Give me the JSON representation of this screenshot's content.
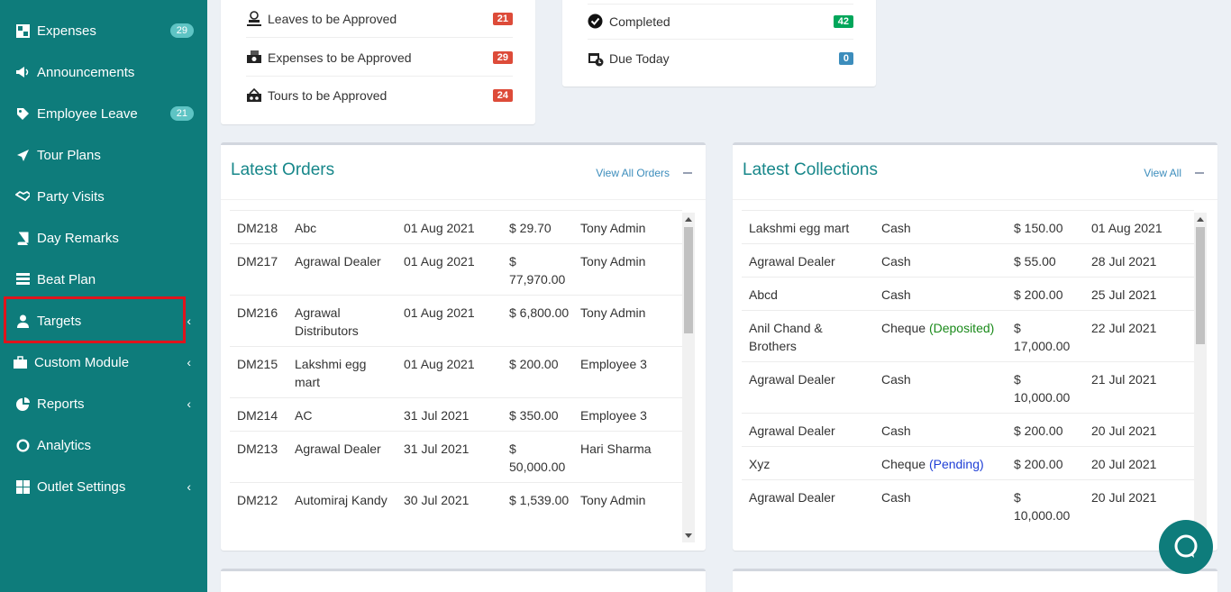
{
  "sidebar": {
    "items": [
      {
        "label": "Expenses",
        "icon": "expenses-icon",
        "badge": "29"
      },
      {
        "label": "Announcements",
        "icon": "bullhorn-icon"
      },
      {
        "label": "Employee Leave",
        "icon": "tag-icon",
        "badge": "21"
      },
      {
        "label": "Tour Plans",
        "icon": "paper-plane-icon"
      },
      {
        "label": "Party Visits",
        "icon": "handshake-icon"
      },
      {
        "label": "Day Remarks",
        "icon": "book-icon"
      },
      {
        "label": "Beat Plan",
        "icon": "list-icon"
      },
      {
        "label": "Targets",
        "icon": "user-icon",
        "chevron": "‹"
      },
      {
        "label": "Custom Module",
        "icon": "briefcase-icon",
        "chevron": "‹"
      },
      {
        "label": "Reports",
        "icon": "pie-chart-icon",
        "chevron": "‹"
      },
      {
        "label": "Analytics",
        "icon": "circle-icon"
      },
      {
        "label": "Outlet Settings",
        "icon": "grid-icon",
        "chevron": "‹"
      }
    ]
  },
  "approvals": [
    {
      "label": "Leaves to be Approved",
      "count": "21"
    },
    {
      "label": "Expenses to be Approved",
      "count": "29"
    },
    {
      "label": "Tours to be Approved",
      "count": "24"
    }
  ],
  "tasks": [
    {
      "label": "Completed",
      "count": "42"
    },
    {
      "label": "Due Today",
      "count": "0"
    }
  ],
  "orders": {
    "title": "Latest Orders",
    "view_all": "View All Orders",
    "rows": [
      {
        "id": "DM218",
        "party": "Abc",
        "date": "01 Aug 2021",
        "amount": "$ 29.70",
        "by": "Tony Admin"
      },
      {
        "id": "DM217",
        "party": "Agrawal Dealer",
        "date": "01 Aug 2021",
        "amount": "$ 77,970.00",
        "by": "Tony Admin"
      },
      {
        "id": "DM216",
        "party": "Agrawal Distributors",
        "date": "01 Aug 2021",
        "amount": "$ 6,800.00",
        "by": "Tony Admin"
      },
      {
        "id": "DM215",
        "party": "Lakshmi egg mart",
        "date": "01 Aug 2021",
        "amount": "$ 200.00",
        "by": "Employee 3"
      },
      {
        "id": "DM214",
        "party": "AC",
        "date": "31 Jul 2021",
        "amount": "$ 350.00",
        "by": "Employee 3"
      },
      {
        "id": "DM213",
        "party": "Agrawal Dealer",
        "date": "31 Jul 2021",
        "amount": "$ 50,000.00",
        "by": "Hari Sharma"
      },
      {
        "id": "DM212",
        "party": "Automiraj Kandy",
        "date": "30 Jul 2021",
        "amount": "$ 1,539.00",
        "by": "Tony Admin"
      }
    ]
  },
  "collections": {
    "title": "Latest Collections",
    "view_all": "View All",
    "rows": [
      {
        "party": "Lakshmi egg mart",
        "mode": "Cash",
        "status": "",
        "amount": "$ 150.00",
        "date": "01 Aug 2021"
      },
      {
        "party": "Agrawal Dealer",
        "mode": "Cash",
        "status": "",
        "amount": "$ 55.00",
        "date": "28 Jul 2021"
      },
      {
        "party": "Abcd",
        "mode": "Cash",
        "status": "",
        "amount": "$ 200.00",
        "date": "25 Jul 2021"
      },
      {
        "party": "Anil Chand & Brothers",
        "mode": "Cheque",
        "status": "(Deposited)",
        "amount": "$ 17,000.00",
        "date": "22 Jul 2021"
      },
      {
        "party": "Agrawal Dealer",
        "mode": "Cash",
        "status": "",
        "amount": "$ 10,000.00",
        "date": "21 Jul 2021"
      },
      {
        "party": "Agrawal Dealer",
        "mode": "Cash",
        "status": "",
        "amount": "$ 200.00",
        "date": "20 Jul 2021"
      },
      {
        "party": "Xyz",
        "mode": "Cheque",
        "status": "(Pending)",
        "amount": "$ 200.00",
        "date": "20 Jul 2021"
      },
      {
        "party": "Agrawal Dealer",
        "mode": "Cash",
        "status": "",
        "amount": "$ 10,000.00",
        "date": "20 Jul 2021"
      }
    ]
  },
  "colors": {
    "sidebar": "#0e7c7b",
    "accent": "#17878a",
    "highlight": "#e0141c"
  }
}
